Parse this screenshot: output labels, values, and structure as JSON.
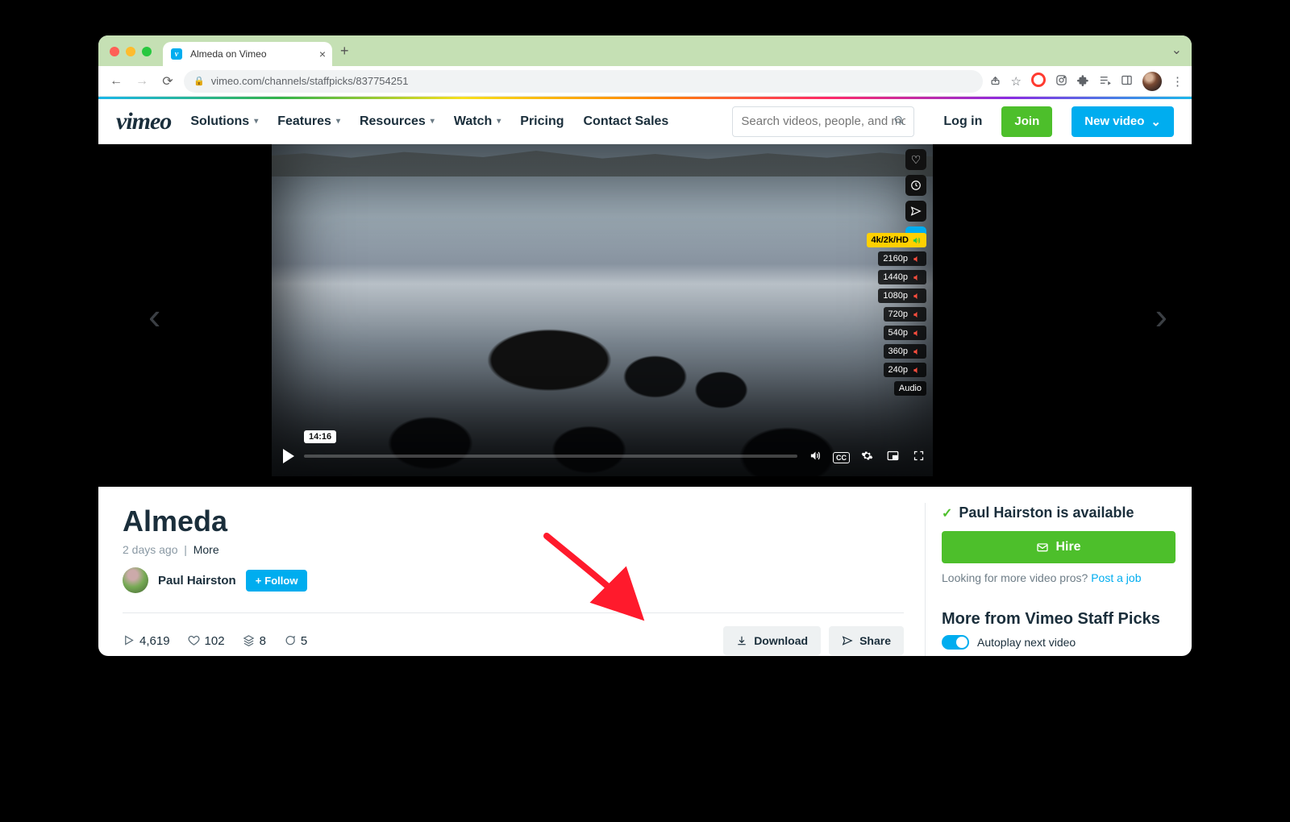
{
  "tab": {
    "title": "Almeda on Vimeo"
  },
  "url": "vimeo.com/channels/staffpicks/837754251",
  "nav": {
    "logo": "vimeo",
    "links": [
      "Solutions",
      "Features",
      "Resources",
      "Watch",
      "Pricing",
      "Contact Sales"
    ],
    "search_placeholder": "Search videos, people, and more",
    "login": "Log in",
    "join": "Join",
    "new_video": "New video"
  },
  "player": {
    "timecode": "14:16",
    "quality_header": "4k/2k/HD",
    "qualities": [
      "2160p",
      "1440p",
      "1080p",
      "720p",
      "540p",
      "360p",
      "240p",
      "Audio"
    ]
  },
  "video": {
    "title": "Almeda",
    "age": "2 days ago",
    "more": "More",
    "author": "Paul Hairston",
    "follow": "Follow"
  },
  "stats": {
    "plays": "4,619",
    "likes": "102",
    "collections": "8",
    "comments": "5"
  },
  "actions": {
    "download": "Download",
    "share": "Share"
  },
  "side": {
    "available": "Paul Hairston is available",
    "hire": "Hire",
    "looking": "Looking for more video pros?",
    "post": "Post a job",
    "more_header": "More from Vimeo Staff Picks",
    "autoplay": "Autoplay next video"
  }
}
